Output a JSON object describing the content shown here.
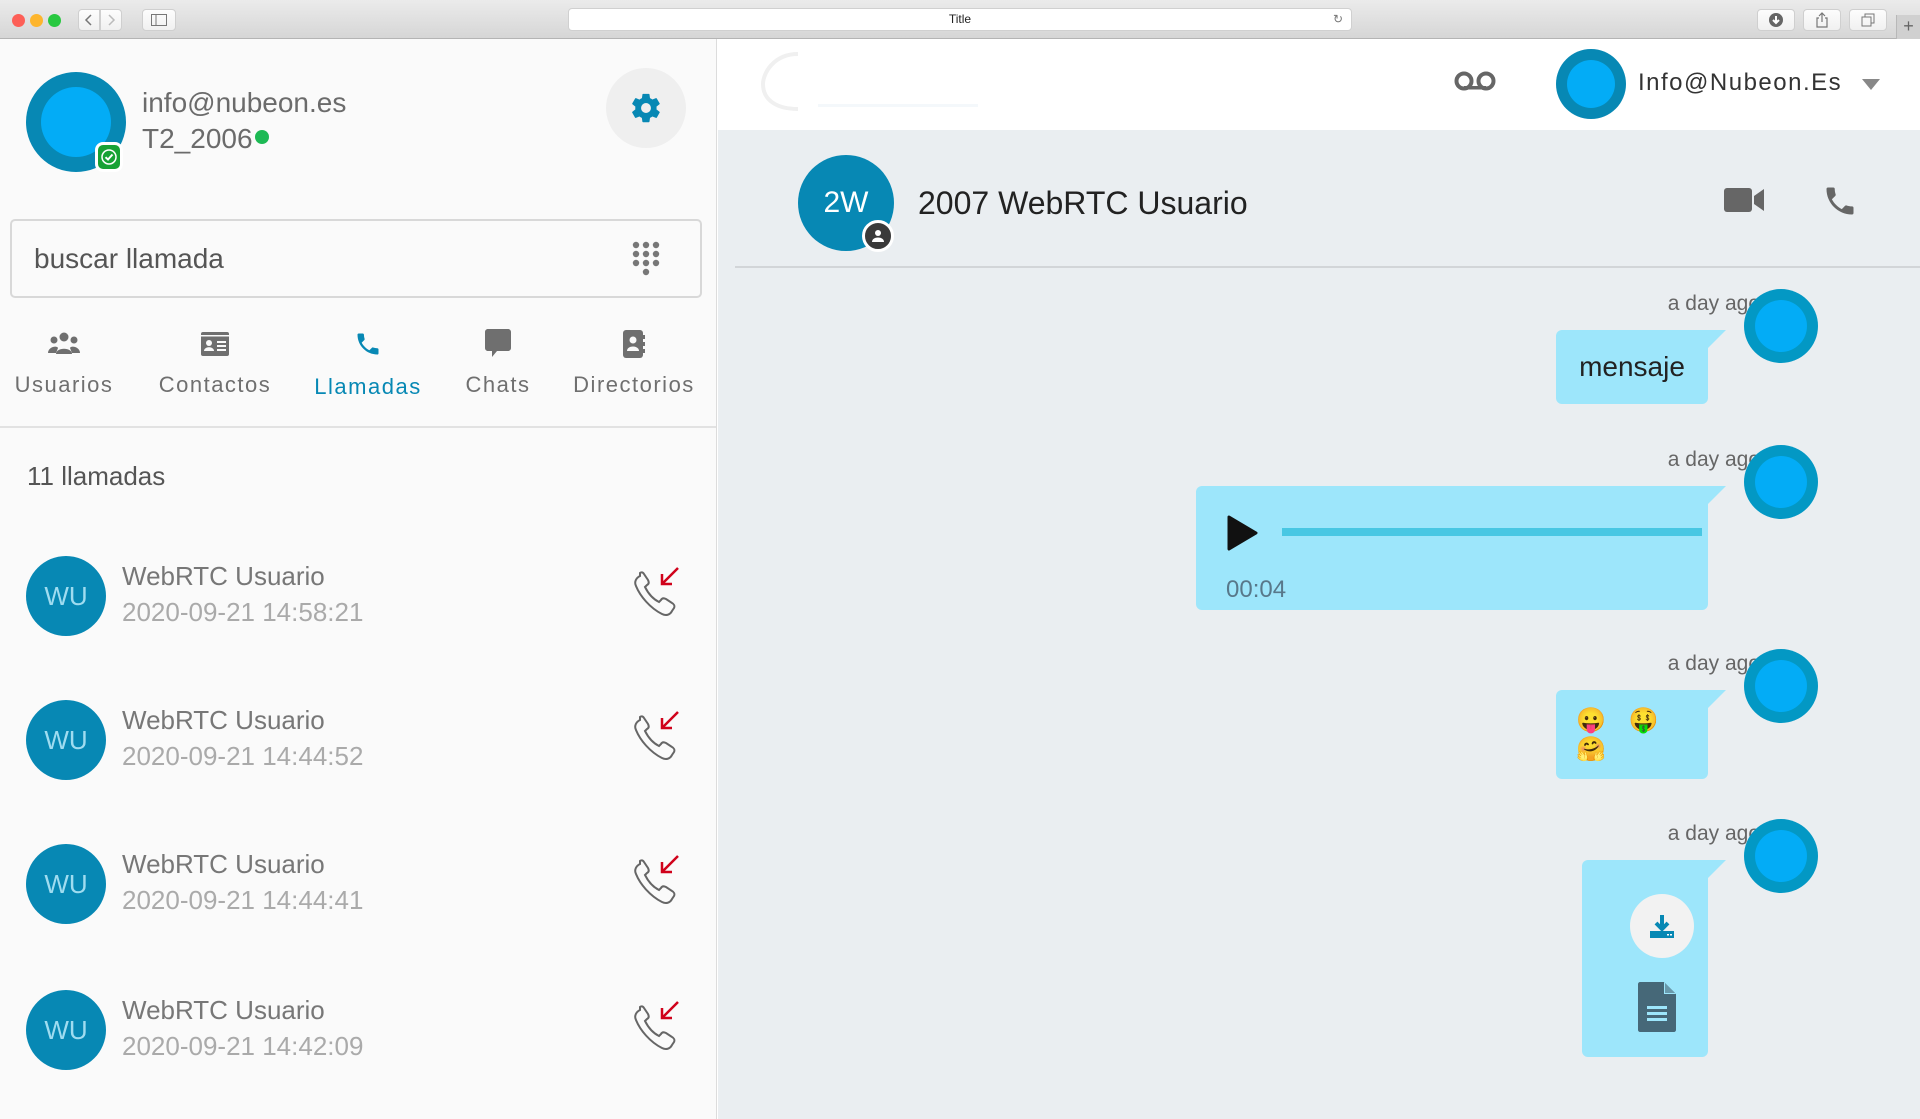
{
  "browser": {
    "url_title": "Title",
    "back_icon": "chevron-left-icon",
    "forward_icon": "chevron-right-icon",
    "sidebar_icon": "sidebar-icon",
    "reload_icon": "reload-icon",
    "download_icon": "download-icon",
    "share_icon": "share-icon",
    "tabs_icon": "tabs-icon",
    "new_tab_label": "+"
  },
  "profile": {
    "email": "info@nubeon.es",
    "extension": "T2_2006",
    "status": "online",
    "verified": true,
    "settings_icon": "gear-icon"
  },
  "search": {
    "placeholder": "buscar llamada",
    "value": "",
    "dialpad_icon": "dialpad-icon"
  },
  "tabs": [
    {
      "label": "Usuarios",
      "icon": "users-icon",
      "active": false
    },
    {
      "label": "Contactos",
      "icon": "contact-card-icon",
      "active": false
    },
    {
      "label": "Llamadas",
      "icon": "phone-icon",
      "active": true
    },
    {
      "label": "Chats",
      "icon": "chat-icon",
      "active": false
    },
    {
      "label": "Directorios",
      "icon": "address-book-icon",
      "active": false
    }
  ],
  "calls": {
    "count_label": "11 llamadas",
    "items": [
      {
        "initials": "WU",
        "name": "WebRTC Usuario",
        "datetime": "2020-09-21 14:58:21",
        "type": "missed-incoming"
      },
      {
        "initials": "WU",
        "name": "WebRTC Usuario",
        "datetime": "2020-09-21 14:44:52",
        "type": "missed-incoming"
      },
      {
        "initials": "WU",
        "name": "WebRTC Usuario",
        "datetime": "2020-09-21 14:44:41",
        "type": "missed-incoming"
      },
      {
        "initials": "WU",
        "name": "WebRTC Usuario",
        "datetime": "2020-09-21 14:42:09",
        "type": "missed-incoming"
      }
    ]
  },
  "topbar": {
    "voicemail_icon": "voicemail-icon",
    "user_name": "Info@Nubeon.Es",
    "caret_icon": "caret-down-icon"
  },
  "conversation": {
    "contact_initials": "2W",
    "contact_name": "2007 WebRTC Usuario",
    "video_icon": "video-camera-icon",
    "call_icon": "phone-icon"
  },
  "messages": [
    {
      "type": "text",
      "timestamp": "a day ago",
      "text": "mensaje"
    },
    {
      "type": "audio",
      "timestamp": "a day ago",
      "duration": "00:04",
      "progress": 0
    },
    {
      "type": "emoji",
      "timestamp": "a day ago",
      "text": "😛 🤑 🤗"
    },
    {
      "type": "file",
      "timestamp": "a day ago",
      "download_icon": "download-icon",
      "file_icon": "document-icon"
    }
  ],
  "colors": {
    "accent": "#0788b4",
    "avatar_fill": "#03acf6",
    "bubble": "#9de6fb",
    "online": "#1db954",
    "missed": "#d0021b",
    "chat_bg": "#eaeef1"
  }
}
